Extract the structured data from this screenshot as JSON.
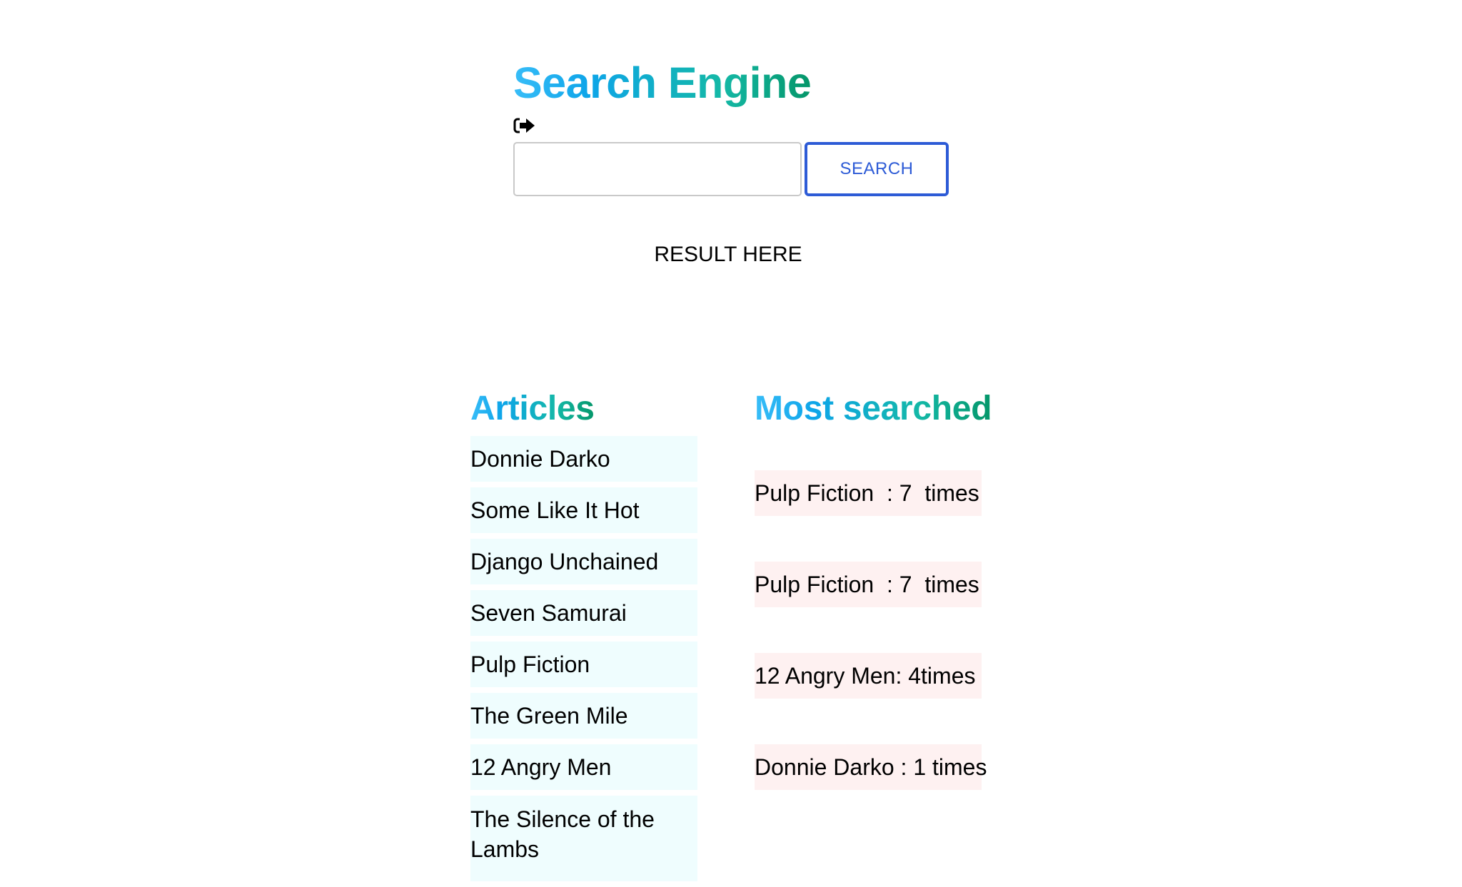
{
  "header": {
    "title": "Search Engine"
  },
  "icons": {
    "exit": "sign-out-icon"
  },
  "search": {
    "value": "",
    "placeholder": "",
    "button_label": "SEARCH"
  },
  "result": {
    "text": "RESULT HERE"
  },
  "articles": {
    "heading": "Articles",
    "items": [
      "Donnie Darko",
      "Some Like It Hot",
      "Django Unchained",
      "Seven Samurai",
      "Pulp Fiction",
      "The Green Mile",
      "12 Angry Men",
      "The Silence of the Lambs"
    ]
  },
  "most_searched": {
    "heading": "Most searched",
    "items": [
      "Pulp Fiction  : 7  times",
      "Pulp Fiction  : 7  times",
      "12 Angry Men: 4times",
      "Donnie Darko : 1 times"
    ]
  },
  "colors": {
    "gradient_start": "#38bdf8",
    "gradient_end": "#059669",
    "button_accent": "#2d5bd6",
    "article_bg": "#effdfe",
    "most_searched_bg": "#fef1f1"
  }
}
